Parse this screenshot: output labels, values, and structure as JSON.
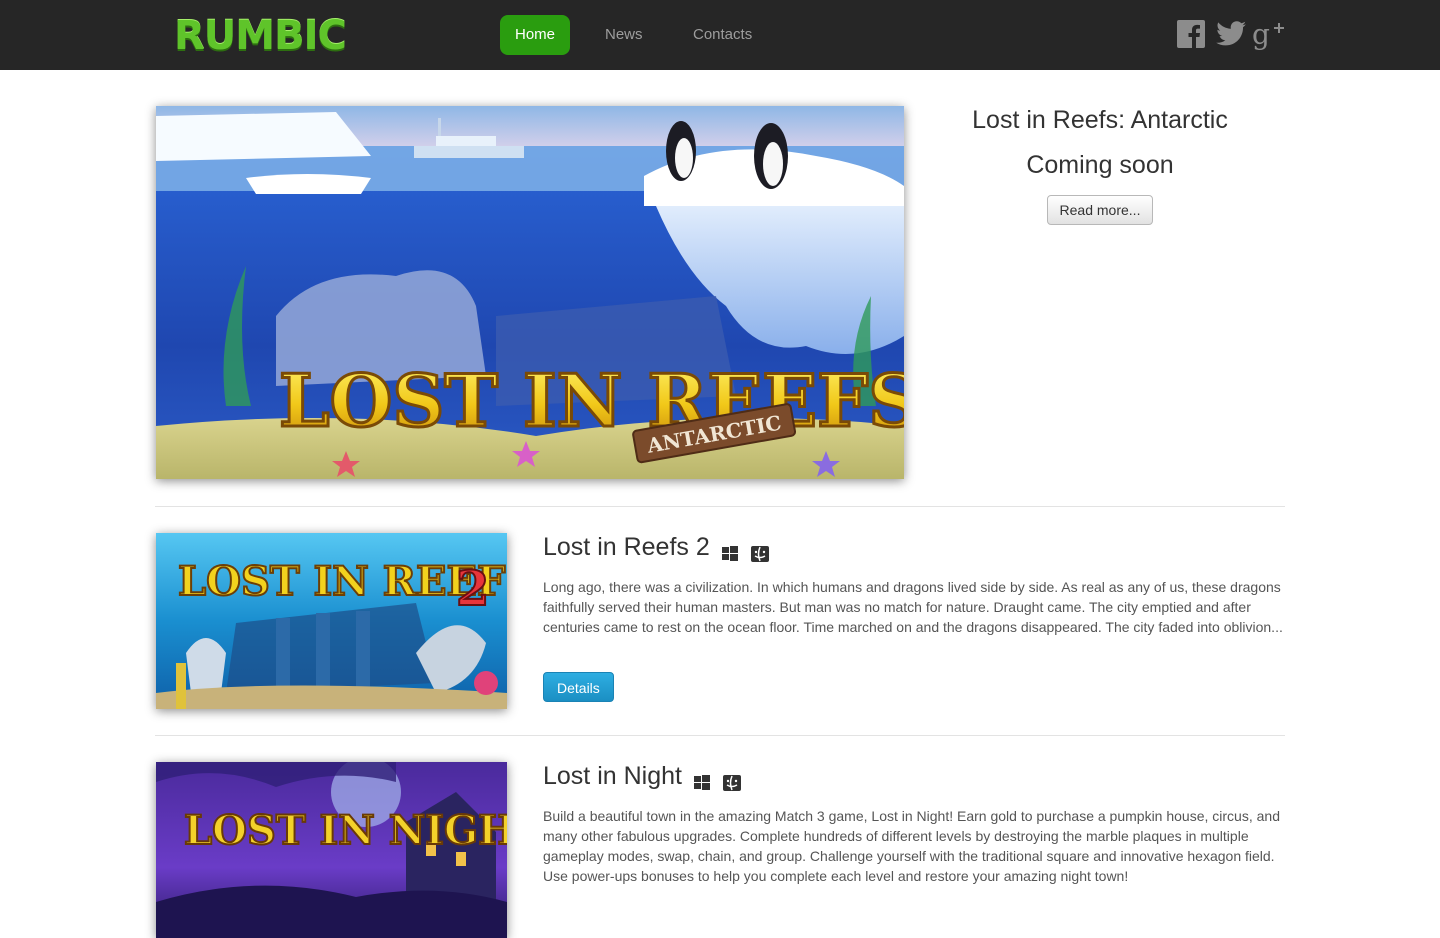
{
  "nav": {
    "logo_text": "RUMBIC",
    "items": [
      {
        "label": "Home",
        "active": true
      },
      {
        "label": "News",
        "active": false
      },
      {
        "label": "Contacts",
        "active": false
      }
    ],
    "social": [
      "facebook-icon",
      "twitter-icon",
      "google-plus-icon"
    ]
  },
  "featured": {
    "title": "Lost in Reefs: Antarctic",
    "status": "Coming soon",
    "read_more": "Read more...",
    "art_title": "LOST IN REEFS",
    "art_subtitle": "ANTARCTIC"
  },
  "games": [
    {
      "title": "Lost in Reefs 2",
      "platforms": [
        "windows-icon",
        "mac-finder-icon"
      ],
      "art_title": "LOST IN REEFS",
      "art_number": "2",
      "description": "Long ago, there was a civilization. In which humans and dragons lived side by side. As real as any of us, these dragons faithfully served their human masters. But man was no match for nature. Draught came. The city emptied and after centuries came to rest on the ocean floor. Time marched on and the dragons disappeared. The city faded into oblivion...",
      "details": "Details"
    },
    {
      "title": "Lost in Night",
      "platforms": [
        "windows-icon",
        "mac-finder-icon"
      ],
      "art_title": "LOST IN NIGHT",
      "description": "Build a beautiful town in the amazing Match 3 game, Lost in Night! Earn gold to purchase a pumpkin house, circus, and many other fabulous upgrades. Complete hundreds of different levels by destroying the marble plaques in multiple gameplay modes, swap, chain, and group. Challenge yourself with the traditional square and innovative hexagon field. Use power-ups bonuses to help you complete each level and restore your amazing night town!"
    }
  ],
  "colors": {
    "navbar_bg": "#262626",
    "nav_active": "#2a9d0f",
    "logo_green": "#5fc42a",
    "details_button": "#1b8fc3"
  }
}
